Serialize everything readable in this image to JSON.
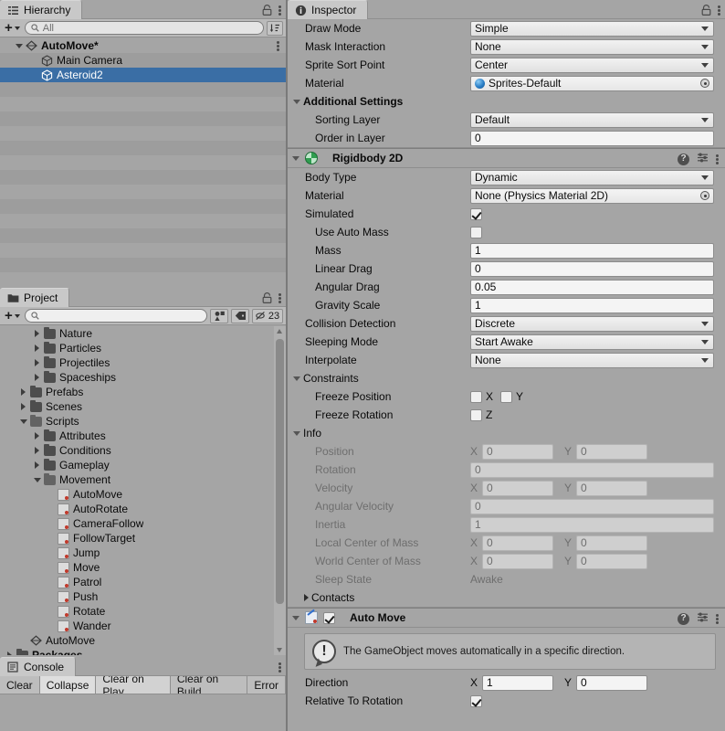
{
  "hierarchy": {
    "tab_label": "Hierarchy",
    "tab_icon": "hierarchy-icon",
    "search_placeholder": "All",
    "search_value": "",
    "create_label": "+",
    "items": [
      {
        "label": "AutoMove*",
        "icon": "scene-icon",
        "depth": 0,
        "expanded": true,
        "bold": true,
        "selected": false
      },
      {
        "label": "Main Camera",
        "icon": "gameobject-icon",
        "depth": 1,
        "expanded": false,
        "bold": false,
        "selected": false
      },
      {
        "label": "Asteroid2",
        "icon": "gameobject-icon",
        "depth": 1,
        "expanded": false,
        "bold": false,
        "selected": true
      }
    ]
  },
  "project": {
    "tab_label": "Project",
    "tab_icon": "folder-icon",
    "search_placeholder": "",
    "search_value": "",
    "create_label": "+",
    "icon_size_count": "23",
    "items": [
      {
        "label": "Nature",
        "type": "folder",
        "depth": 2,
        "state": "collapsed"
      },
      {
        "label": "Particles",
        "type": "folder",
        "depth": 2,
        "state": "collapsed"
      },
      {
        "label": "Projectiles",
        "type": "folder",
        "depth": 2,
        "state": "collapsed"
      },
      {
        "label": "Spaceships",
        "type": "folder",
        "depth": 2,
        "state": "collapsed"
      },
      {
        "label": "Prefabs",
        "type": "folder",
        "depth": 1,
        "state": "collapsed"
      },
      {
        "label": "Scenes",
        "type": "folder",
        "depth": 1,
        "state": "collapsed"
      },
      {
        "label": "Scripts",
        "type": "folder",
        "depth": 1,
        "state": "expanded"
      },
      {
        "label": "Attributes",
        "type": "folder",
        "depth": 2,
        "state": "collapsed"
      },
      {
        "label": "Conditions",
        "type": "folder",
        "depth": 2,
        "state": "collapsed"
      },
      {
        "label": "Gameplay",
        "type": "folder",
        "depth": 2,
        "state": "collapsed"
      },
      {
        "label": "Movement",
        "type": "folder",
        "depth": 2,
        "state": "expanded"
      },
      {
        "label": "AutoMove",
        "type": "script",
        "depth": 3,
        "state": "leaf"
      },
      {
        "label": "AutoRotate",
        "type": "script",
        "depth": 3,
        "state": "leaf"
      },
      {
        "label": "CameraFollow",
        "type": "script",
        "depth": 3,
        "state": "leaf"
      },
      {
        "label": "FollowTarget",
        "type": "script",
        "depth": 3,
        "state": "leaf"
      },
      {
        "label": "Jump",
        "type": "script",
        "depth": 3,
        "state": "leaf"
      },
      {
        "label": "Move",
        "type": "script",
        "depth": 3,
        "state": "leaf"
      },
      {
        "label": "Patrol",
        "type": "script",
        "depth": 3,
        "state": "leaf"
      },
      {
        "label": "Push",
        "type": "script",
        "depth": 3,
        "state": "leaf"
      },
      {
        "label": "Rotate",
        "type": "script",
        "depth": 3,
        "state": "leaf"
      },
      {
        "label": "Wander",
        "type": "script",
        "depth": 3,
        "state": "leaf"
      },
      {
        "label": "AutoMove",
        "type": "scene",
        "depth": 1,
        "state": "leaf"
      },
      {
        "label": "Packages",
        "type": "folder",
        "depth": 0,
        "state": "collapsed",
        "bold": true
      }
    ]
  },
  "console": {
    "tab_label": "Console",
    "tab_icon": "console-icon",
    "buttons": [
      "Clear",
      "Collapse",
      "Clear on Play",
      "Clear on Build",
      "Error"
    ]
  },
  "inspector": {
    "tab_label": "Inspector",
    "tab_icon": "info-icon",
    "sprite_renderer": {
      "rows": [
        {
          "label": "Draw Mode",
          "type": "dropdown",
          "value": "Simple"
        },
        {
          "label": "Mask Interaction",
          "type": "dropdown",
          "value": "None"
        },
        {
          "label": "Sprite Sort Point",
          "type": "dropdown",
          "value": "Center"
        },
        {
          "label": "Material",
          "type": "object",
          "value": "Sprites-Default"
        }
      ],
      "additional_settings": {
        "label": "Additional Settings",
        "expanded": true,
        "rows": [
          {
            "label": "Sorting Layer",
            "type": "dropdown",
            "value": "Default",
            "sub": true
          },
          {
            "label": "Order in Layer",
            "type": "text",
            "value": "0",
            "sub": true
          }
        ]
      }
    },
    "rigidbody2d": {
      "title": "Rigidbody 2D",
      "icon": "rigidbody2d-icon",
      "expanded": true,
      "rows": [
        {
          "label": "Body Type",
          "type": "dropdown",
          "value": "Dynamic"
        },
        {
          "label": "Material",
          "type": "object",
          "value": "None (Physics Material 2D)"
        },
        {
          "label": "Simulated",
          "type": "checkbox",
          "checked": true
        },
        {
          "label": "Use Auto Mass",
          "type": "checkbox",
          "checked": false,
          "sub": true
        },
        {
          "label": "Mass",
          "type": "text",
          "value": "1",
          "sub": true
        },
        {
          "label": "Linear Drag",
          "type": "text",
          "value": "0",
          "sub": true
        },
        {
          "label": "Angular Drag",
          "type": "text",
          "value": "0.05",
          "sub": true
        },
        {
          "label": "Gravity Scale",
          "type": "text",
          "value": "1",
          "sub": true
        },
        {
          "label": "Collision Detection",
          "type": "dropdown",
          "value": "Discrete"
        },
        {
          "label": "Sleeping Mode",
          "type": "dropdown",
          "value": "Start Awake"
        },
        {
          "label": "Interpolate",
          "type": "dropdown",
          "value": "None"
        }
      ],
      "constraints": {
        "label": "Constraints",
        "expanded": true,
        "freeze_position": {
          "label": "Freeze Position",
          "x_label": "X",
          "x_checked": false,
          "y_label": "Y",
          "y_checked": false
        },
        "freeze_rotation": {
          "label": "Freeze Rotation",
          "z_label": "Z",
          "z_checked": false
        }
      },
      "info": {
        "label": "Info",
        "expanded": true,
        "rows": [
          {
            "label": "Position",
            "type": "vec2",
            "x_label": "X",
            "x": "0",
            "y_label": "Y",
            "y": "0"
          },
          {
            "label": "Rotation",
            "type": "text",
            "value": "0"
          },
          {
            "label": "Velocity",
            "type": "vec2",
            "x_label": "X",
            "x": "0",
            "y_label": "Y",
            "y": "0"
          },
          {
            "label": "Angular Velocity",
            "type": "text",
            "value": "0"
          },
          {
            "label": "Inertia",
            "type": "text",
            "value": "1"
          },
          {
            "label": "Local Center of Mass",
            "type": "vec2",
            "x_label": "X",
            "x": "0",
            "y_label": "Y",
            "y": "0"
          },
          {
            "label": "World Center of Mass",
            "type": "vec2",
            "x_label": "X",
            "x": "0",
            "y_label": "Y",
            "y": "0"
          },
          {
            "label": "Sleep State",
            "type": "static",
            "value": "Awake"
          }
        ],
        "contacts": {
          "label": "Contacts",
          "expanded": false
        }
      }
    },
    "auto_move": {
      "title": "Auto Move",
      "icon": "monoscript-icon",
      "enabled": true,
      "expanded": true,
      "help_text": "The GameObject moves automatically in a specific direction.",
      "rows": [
        {
          "label": "Direction",
          "type": "vec2",
          "x_label": "X",
          "x": "1",
          "y_label": "Y",
          "y": "0"
        },
        {
          "label": "Relative To Rotation",
          "type": "checkbox",
          "checked": true
        }
      ]
    }
  }
}
